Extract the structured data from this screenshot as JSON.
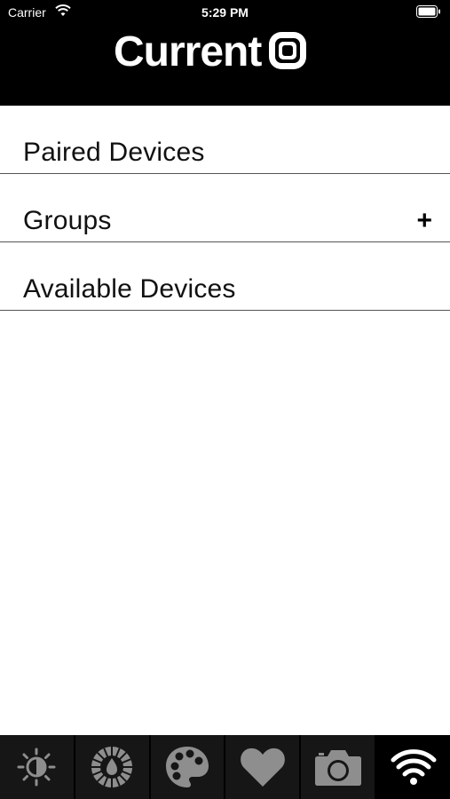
{
  "status_bar": {
    "carrier": "Carrier",
    "time": "5:29 PM"
  },
  "header": {
    "logo_text": "Current",
    "logo_icon": "current-logo-mark"
  },
  "list": {
    "rows": [
      {
        "label": "Paired Devices",
        "action": ""
      },
      {
        "label": "Groups",
        "action": "+"
      },
      {
        "label": "Available Devices",
        "action": ""
      }
    ]
  },
  "tabbar": {
    "tabs": [
      {
        "icon": "brightness-icon",
        "selected": false
      },
      {
        "icon": "color-temperature-icon",
        "selected": false
      },
      {
        "icon": "palette-icon",
        "selected": false
      },
      {
        "icon": "heart-icon",
        "selected": false
      },
      {
        "icon": "camera-icon",
        "selected": false
      },
      {
        "icon": "wifi-icon",
        "selected": true
      }
    ],
    "colors": {
      "active": "#ffffff",
      "inactive": "#8e8e8e",
      "background": "#000000"
    }
  }
}
